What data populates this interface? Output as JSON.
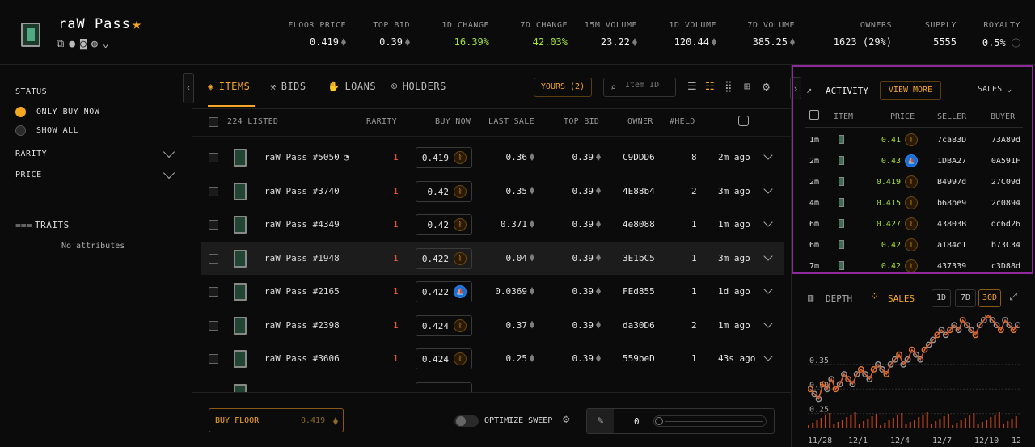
{
  "collection": {
    "name": "raW Pass"
  },
  "stats": [
    {
      "label": "FLOOR PRICE",
      "value": "0.419",
      "eth": true
    },
    {
      "label": "TOP BID",
      "value": "0.39",
      "eth": true
    },
    {
      "label": "1D CHANGE",
      "value": "16.39%",
      "eth": false,
      "positive": true
    },
    {
      "label": "7D CHANGE",
      "value": "42.03%",
      "eth": false,
      "positive": true
    },
    {
      "label": "15M VOLUME",
      "value": "23.22",
      "eth": true
    },
    {
      "label": "1D VOLUME",
      "value": "120.44",
      "eth": true
    },
    {
      "label": "7D VOLUME",
      "value": "385.25",
      "eth": true
    },
    {
      "label": "OWNERS",
      "value": "1623 (29%)",
      "eth": false
    },
    {
      "label": "SUPPLY",
      "value": "5555",
      "eth": false
    },
    {
      "label": "ROYALTY",
      "value": "0.5%",
      "eth": false
    }
  ],
  "sidebar": {
    "status_label": "STATUS",
    "only_buy_now": "ONLY BUY NOW",
    "show_all": "SHOW ALL",
    "rarity": "RARITY",
    "price": "PRICE",
    "traits": "TRAITS",
    "no_attributes": "No attributes"
  },
  "tabs": [
    "ITEMS",
    "BIDS",
    "LOANS",
    "HOLDERS"
  ],
  "yours_button": "YOURS (2)",
  "search": {
    "placeholder": "Item ID"
  },
  "table": {
    "listed": "224 LISTED",
    "headers": {
      "rarity": "RARITY",
      "buy_now": "BUY NOW",
      "last_sale": "LAST SALE",
      "top_bid": "TOP BID",
      "owner": "OWNER",
      "held": "#HELD"
    },
    "rows": [
      {
        "name": "raW Pass #5050",
        "rarity": "1",
        "price": "0.419",
        "marketplace": "mk",
        "last_sale": "0.36",
        "top_bid": "0.39",
        "owner": "C9DDD6",
        "held": "8",
        "time": "2m ago"
      },
      {
        "name": "raW Pass #3740",
        "rarity": "1",
        "price": "0.42",
        "marketplace": "mk",
        "last_sale": "0.35",
        "top_bid": "0.39",
        "owner": "4E88b4",
        "held": "2",
        "time": "3m ago"
      },
      {
        "name": "raW Pass #4349",
        "rarity": "1",
        "price": "0.42",
        "marketplace": "mk",
        "last_sale": "0.371",
        "top_bid": "0.39",
        "owner": "4e8088",
        "held": "1",
        "time": "1m ago"
      },
      {
        "name": "raW Pass #1948",
        "rarity": "1",
        "price": "0.422",
        "marketplace": "mk",
        "last_sale": "0.04",
        "top_bid": "0.39",
        "owner": "3E1bC5",
        "held": "1",
        "time": "3m ago"
      },
      {
        "name": "raW Pass #2165",
        "rarity": "1",
        "price": "0.422",
        "marketplace": "os",
        "last_sale": "0.0369",
        "top_bid": "0.39",
        "owner": "FEd855",
        "held": "1",
        "time": "1d ago"
      },
      {
        "name": "raW Pass #2398",
        "rarity": "1",
        "price": "0.424",
        "marketplace": "mk",
        "last_sale": "0.37",
        "top_bid": "0.39",
        "owner": "da30D6",
        "held": "2",
        "time": "1m ago"
      },
      {
        "name": "raW Pass #3606",
        "rarity": "1",
        "price": "0.424",
        "marketplace": "mk",
        "last_sale": "0.25",
        "top_bid": "0.39",
        "owner": "559beD",
        "held": "1",
        "time": "43s ago"
      }
    ]
  },
  "bottom": {
    "buy_floor": "BUY FLOOR",
    "buy_floor_price": "0.419",
    "optimize_sweep": "OPTIMIZE SWEEP",
    "sweep_count": "0"
  },
  "activity": {
    "title": "ACTIVITY",
    "view_more": "VIEW MORE",
    "filter": "SALES",
    "headers": {
      "item": "ITEM",
      "price": "PRICE",
      "seller": "SELLER",
      "buyer": "BUYER"
    },
    "rows": [
      {
        "time": "1m",
        "price": "0.41",
        "mk": "mk",
        "seller": "7ca83D",
        "buyer": "73A89d"
      },
      {
        "time": "2m",
        "price": "0.43",
        "mk": "os",
        "seller": "1DBA27",
        "buyer": "0A591F"
      },
      {
        "time": "2m",
        "price": "0.419",
        "mk": "mk",
        "seller": "B4997d",
        "buyer": "27C09d"
      },
      {
        "time": "4m",
        "price": "0.415",
        "mk": "mk",
        "seller": "b68be9",
        "buyer": "2c0894"
      },
      {
        "time": "6m",
        "price": "0.427",
        "mk": "mk",
        "seller": "43803B",
        "buyer": "dc6d26"
      },
      {
        "time": "6m",
        "price": "0.42",
        "mk": "mk",
        "seller": "a184c1",
        "buyer": "b73C34"
      },
      {
        "time": "7m",
        "price": "0.42",
        "mk": "mk",
        "seller": "437339",
        "buyer": "c3D88d"
      }
    ]
  },
  "chart_tabs": {
    "depth": "DEPTH",
    "sales": "SALES",
    "periods": [
      "1D",
      "7D",
      "30D"
    ],
    "active_period": "30D"
  },
  "chart_data": {
    "type": "scatter",
    "title": "",
    "xlabel": "",
    "ylabel": "",
    "x_ticks": [
      "11/28",
      "12/1",
      "12/4",
      "12/7",
      "12/10",
      "12"
    ],
    "y_ticks": [
      "0.35",
      "0.30",
      "0.25"
    ],
    "series": [
      {
        "values": [
          [
            0,
            0.3
          ],
          [
            2,
            0.29
          ],
          [
            4,
            0.28
          ],
          [
            6,
            0.31
          ],
          [
            8,
            0.3
          ],
          [
            10,
            0.32
          ],
          [
            12,
            0.3
          ],
          [
            14,
            0.31
          ],
          [
            16,
            0.33
          ],
          [
            18,
            0.32
          ],
          [
            20,
            0.31
          ],
          [
            22,
            0.33
          ],
          [
            24,
            0.34
          ],
          [
            26,
            0.33
          ],
          [
            28,
            0.32
          ],
          [
            30,
            0.34
          ],
          [
            32,
            0.35
          ],
          [
            34,
            0.34
          ],
          [
            36,
            0.33
          ],
          [
            38,
            0.35
          ],
          [
            40,
            0.36
          ],
          [
            42,
            0.37
          ],
          [
            44,
            0.35
          ],
          [
            46,
            0.36
          ],
          [
            48,
            0.38
          ],
          [
            50,
            0.37
          ],
          [
            52,
            0.36
          ],
          [
            54,
            0.38
          ],
          [
            56,
            0.39
          ],
          [
            58,
            0.4
          ],
          [
            60,
            0.41
          ],
          [
            62,
            0.42
          ],
          [
            64,
            0.41
          ],
          [
            66,
            0.42
          ],
          [
            68,
            0.43
          ],
          [
            70,
            0.42
          ],
          [
            72,
            0.44
          ],
          [
            74,
            0.43
          ],
          [
            76,
            0.42
          ],
          [
            78,
            0.41
          ],
          [
            80,
            0.43
          ],
          [
            82,
            0.44
          ],
          [
            84,
            0.45
          ],
          [
            86,
            0.44
          ],
          [
            88,
            0.43
          ],
          [
            90,
            0.42
          ],
          [
            92,
            0.44
          ],
          [
            94,
            0.43
          ],
          [
            96,
            0.42
          ],
          [
            98,
            0.43
          ]
        ]
      }
    ]
  }
}
